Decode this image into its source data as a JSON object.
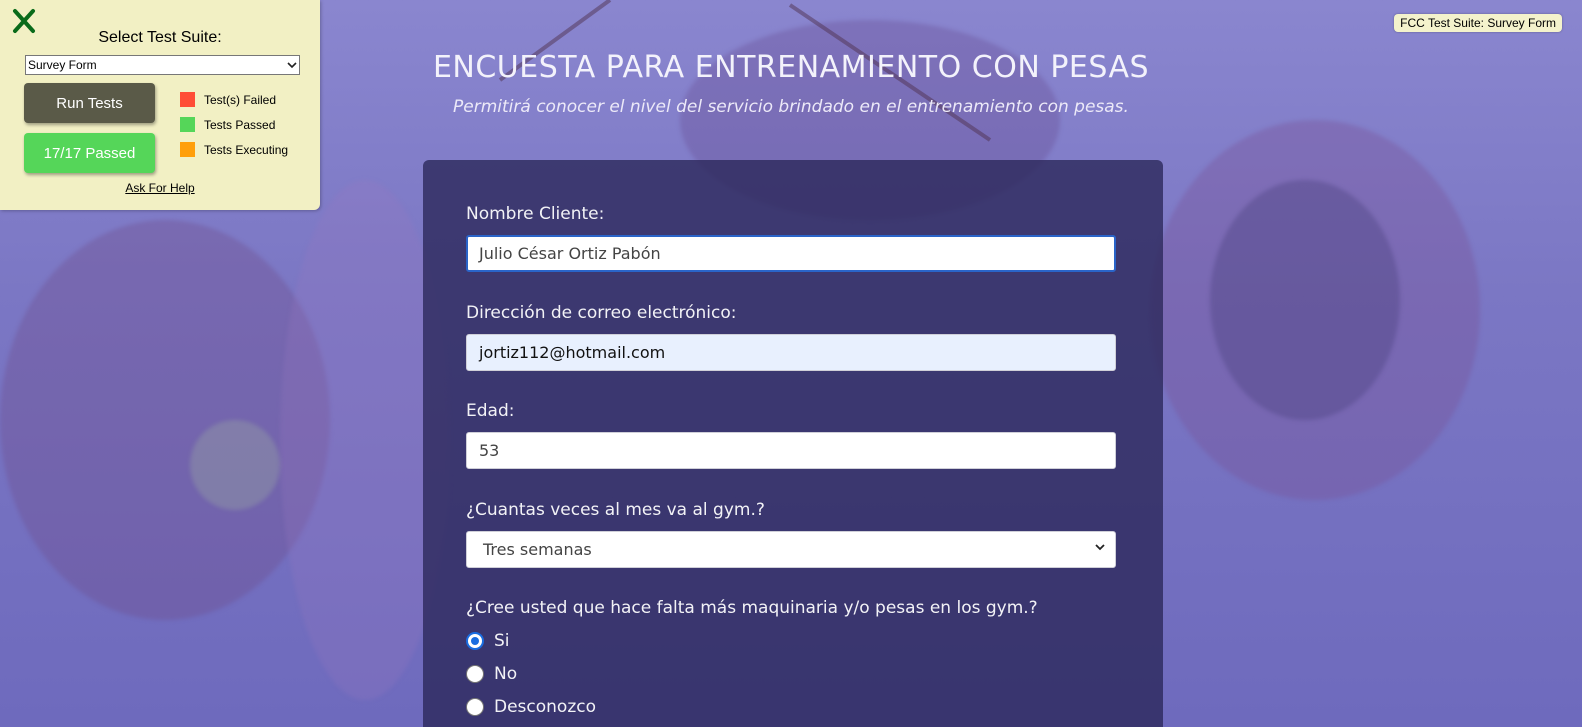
{
  "fcc_panel": {
    "title": "Select Test Suite:",
    "suite_selected": "Survey Form",
    "run_button": "Run Tests",
    "pass_button": "17/17 Passed",
    "legend": {
      "failed": "Test(s) Failed",
      "passed": "Tests Passed",
      "executing": "Tests Executing"
    },
    "legend_colors": {
      "failed": "#ff4d36",
      "passed": "#55d659",
      "executing": "#ff9f0a"
    },
    "help_link": "Ask For Help",
    "close_icon": "close-x-icon"
  },
  "fcc_badge": "FCC Test Suite: Survey Form",
  "header": {
    "title": "ENCUESTA PARA ENTRENAMIENTO CON PESAS",
    "description": "Permitirá conocer el nivel del servicio brindado en el entrenamiento con pesas."
  },
  "form": {
    "name_label": "Nombre Cliente:",
    "name_value": "Julio César Ortiz Pabón",
    "email_label": "Dirección de correo electrónico:",
    "email_value": "jortiz112@hotmail.com",
    "age_label": "Edad:",
    "age_value": "53",
    "gym_label": "¿Cuantas veces al mes va al gym.?",
    "gym_selected": "Tres semanas",
    "machinery_label": "¿Cree usted que hace falta más maquinaria y/o pesas en los gym.?",
    "machinery_options": [
      "Si",
      "No",
      "Desconozco"
    ],
    "machinery_selected": "Si"
  }
}
